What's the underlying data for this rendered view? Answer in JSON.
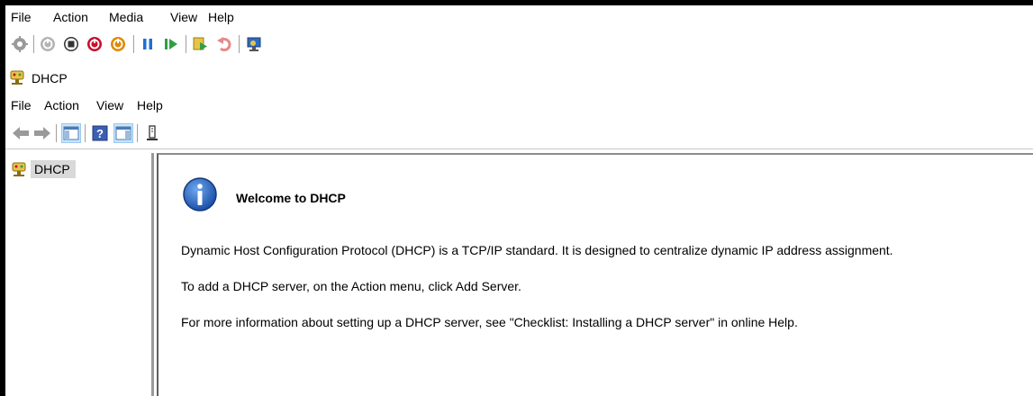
{
  "menubar": {
    "items": [
      "File",
      "Action",
      "Media",
      "View",
      "Help"
    ]
  },
  "toolbar": {
    "icons": [
      "settings-icon",
      "reset-icon",
      "stop-icon",
      "shutdown-icon",
      "power-icon",
      "pause-icon",
      "start-icon",
      "checkpoint-icon",
      "revert-icon",
      "enhanced-session-icon"
    ]
  },
  "window": {
    "title": "DHCP"
  },
  "mmc_menubar": {
    "items": [
      "File",
      "Action",
      "View",
      "Help"
    ]
  },
  "mmc_toolbar": {
    "icons": [
      "back-arrow-icon",
      "forward-arrow-icon",
      "show-hide-console-tree-icon",
      "help-icon",
      "show-hide-action-pane-icon",
      "audit-icon"
    ]
  },
  "tree": {
    "root_label": "DHCP"
  },
  "content": {
    "heading": "Welcome to DHCP",
    "paragraphs": [
      "Dynamic Host Configuration Protocol (DHCP) is a TCP/IP standard. It is designed to centralize dynamic IP address assignment.",
      "To add a DHCP server, on the Action menu, click Add Server.",
      "For more information about setting up a DHCP server, see \"Checklist: Installing a DHCP server\" in online Help."
    ]
  }
}
